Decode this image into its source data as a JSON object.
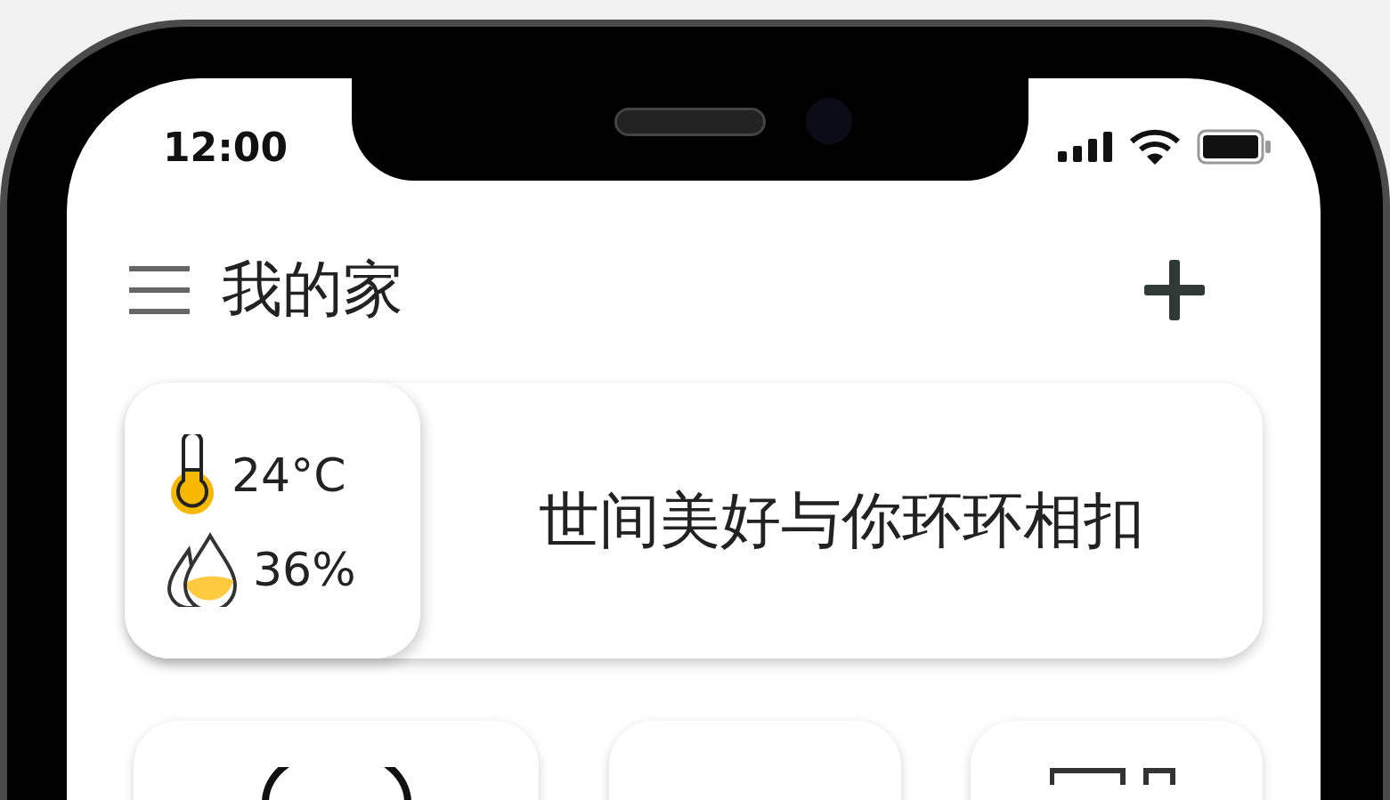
{
  "status_bar": {
    "time": "12:00"
  },
  "header": {
    "title": "我的家"
  },
  "climate": {
    "temperature": "24°C",
    "humidity": "36%"
  },
  "slogan": "世间美好与你环环相扣"
}
